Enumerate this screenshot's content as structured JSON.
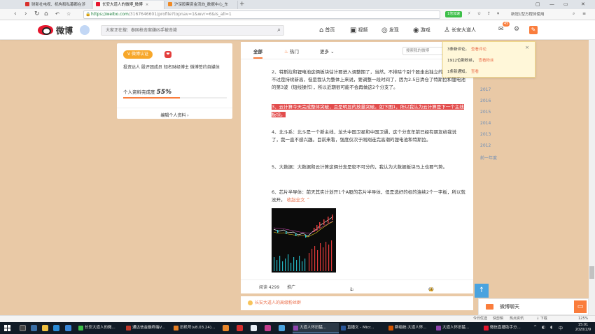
{
  "browser": {
    "tabs": [
      {
        "label": "财新社电视、机构和私募都在涉",
        "color": "#d9302c"
      },
      {
        "label": "长安大道人的微博_微博",
        "color": "#e6162d",
        "active": true
      },
      {
        "label": "沪深股票资金流向_数据中心_东",
        "color": "#f08a24"
      }
    ],
    "url_host": "https://weibo.com",
    "url_path": "/3167646601/profile?topnav=1&wvr=6&is_all=1",
    "url_pill": "1倍加速",
    "search_placeholder": "新冠1型方程体使用",
    "window_controls": [
      "▢",
      "—",
      "▭",
      "✕"
    ]
  },
  "weibo_header": {
    "logo_text": "微博",
    "search_placeholder": "大家正在搜：泰国枪击案嫌凶手被击毙",
    "nav": [
      {
        "label": "首页",
        "icon": "home-icon",
        "glyph": "⌂"
      },
      {
        "label": "视频",
        "icon": "video-icon",
        "glyph": "▣"
      },
      {
        "label": "发现",
        "icon": "discover-icon",
        "glyph": "◎"
      },
      {
        "label": "游戏",
        "icon": "game-icon",
        "glyph": "◉"
      },
      {
        "label": "长安大道人",
        "icon": "user-icon",
        "glyph": "♙"
      }
    ],
    "message_badge": "45"
  },
  "profile_card": {
    "verified_label": "微博认证",
    "description": "投资达人 股评团成员 知名财经博主 微博签约自媒体",
    "completeness_label": "个人资料完成度",
    "completeness_value": "55%",
    "completeness_fraction": 0.55,
    "edit_label": "编辑个人资料"
  },
  "feed": {
    "tabs": [
      "全部",
      "热门",
      "更多"
    ],
    "search_placeholder": "搜索我的微博",
    "paragraphs": [
      {
        "text": "2、特斯拉和锂电池这俩板块估计要进入调整期了，当然，不排除个别个股走出独立的走势，只不过是持续新高，但是我认为整体上来说，要调整一段时间了，因为2.5日清仓了特斯拉和锂电池的第3波（短线操作），所以近期很可能不会再做这2个分支了。",
        "highlight": false
      },
      {
        "text": "3、云计算今天完成整体突破，且是明显的放量突破。如下图1，所以我认为云计算是下一个主线板块。",
        "highlight": true
      },
      {
        "text": "4、北斗系：北斗是一个新主线，龙头中国卫星和中国卫通，这个分支年前已经有朋友给我说了，我一直不感兴趣。目前来看，强度仅次于刚刚走完高潮的锂电池和特斯拉。",
        "highlight": false
      },
      {
        "text": "5、大数据：大数据和云计算这俩分支是密不可分的，我认为大数据板块马上也要气势。",
        "highlight": false
      },
      {
        "text": "6、芯片半导体：前天其实计划开1个A股的芯片半导体，但是选好的标的连续2个一字板，所以就没开。",
        "highlight": false
      }
    ],
    "collapse_label": "收起全文 ⌃",
    "reads": "阅读 4299",
    "promote": "推广",
    "comments": "1",
    "likes": "60"
  },
  "card2_link": "长安大道人的高级粉丝群",
  "right_column": {
    "years": [
      "2017",
      "2016",
      "2015",
      "2014",
      "2013",
      "2012"
    ],
    "last_year": "前一年度"
  },
  "notification": {
    "items": [
      {
        "text": "3条新评论，",
        "link": "查看评论"
      },
      {
        "text": "1912位新粉丝，",
        "link": "查看粉丝"
      },
      {
        "text": "1条新通知，",
        "link": "查看"
      }
    ],
    "close": "×"
  },
  "chat": {
    "label": "微博聊天"
  },
  "statusbar": {
    "left": "",
    "items": [
      "今日优选",
      "快剪辑",
      "热点资讯",
      "↓ 下载",
      "125%"
    ]
  },
  "taskbar": {
    "items": [
      {
        "label": "长安大道人的微...",
        "color": "#3cbf48"
      },
      {
        "label": "通达信金融终端V...",
        "color": "#c0392b"
      },
      {
        "label": "旧机号(v8.03.24)...",
        "color": "#e67e22"
      },
      {
        "label": "大道人怀旧猛...",
        "color": "#8e44ad",
        "active": true
      },
      {
        "label": "直播文 - Micr...",
        "color": "#2b579a"
      },
      {
        "label": "群组统·大道人怀...",
        "color": "#d35400"
      },
      {
        "label": "大道人怀旧猛...",
        "color": "#8e44ad"
      },
      {
        "label": "微信直播助手分...",
        "color": "#e6162d"
      }
    ],
    "time": "15:01",
    "date": "2020/2/9"
  }
}
